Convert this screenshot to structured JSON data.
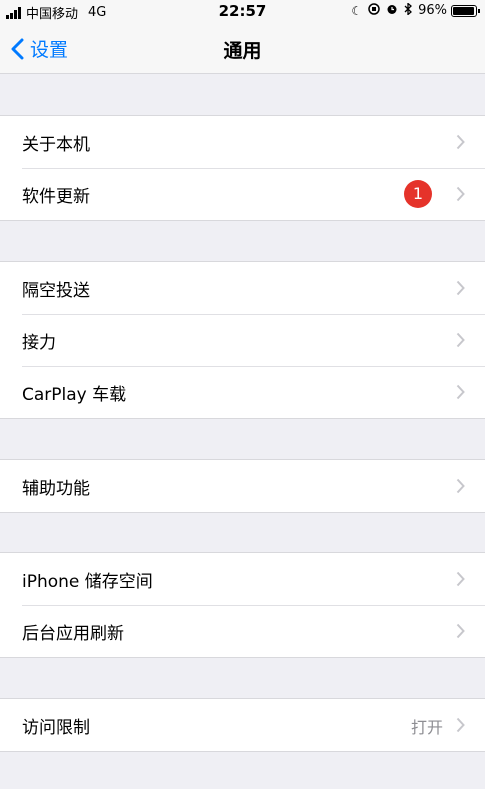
{
  "status_bar": {
    "carrier": "中国移动",
    "network": "4G",
    "time": "22:57",
    "battery_percent": "96%",
    "battery_level": 0.96,
    "icons": [
      "moon-icon",
      "orientation-lock-icon",
      "alarm-icon",
      "bluetooth-icon"
    ]
  },
  "nav": {
    "back_label": "设置",
    "title": "通用"
  },
  "groups": [
    {
      "rows": [
        {
          "label": "关于本机"
        },
        {
          "label": "软件更新",
          "badge": "1"
        }
      ]
    },
    {
      "rows": [
        {
          "label": "隔空投送"
        },
        {
          "label": "接力"
        },
        {
          "label": "CarPlay 车载"
        }
      ]
    },
    {
      "rows": [
        {
          "label": "辅助功能"
        }
      ]
    },
    {
      "rows": [
        {
          "label": "iPhone 储存空间"
        },
        {
          "label": "后台应用刷新"
        }
      ]
    },
    {
      "rows": [
        {
          "label": "访问限制",
          "value": "打开"
        }
      ]
    }
  ],
  "colors": {
    "accent": "#007aff",
    "badge": "#e5332a",
    "background": "#efeff4"
  }
}
